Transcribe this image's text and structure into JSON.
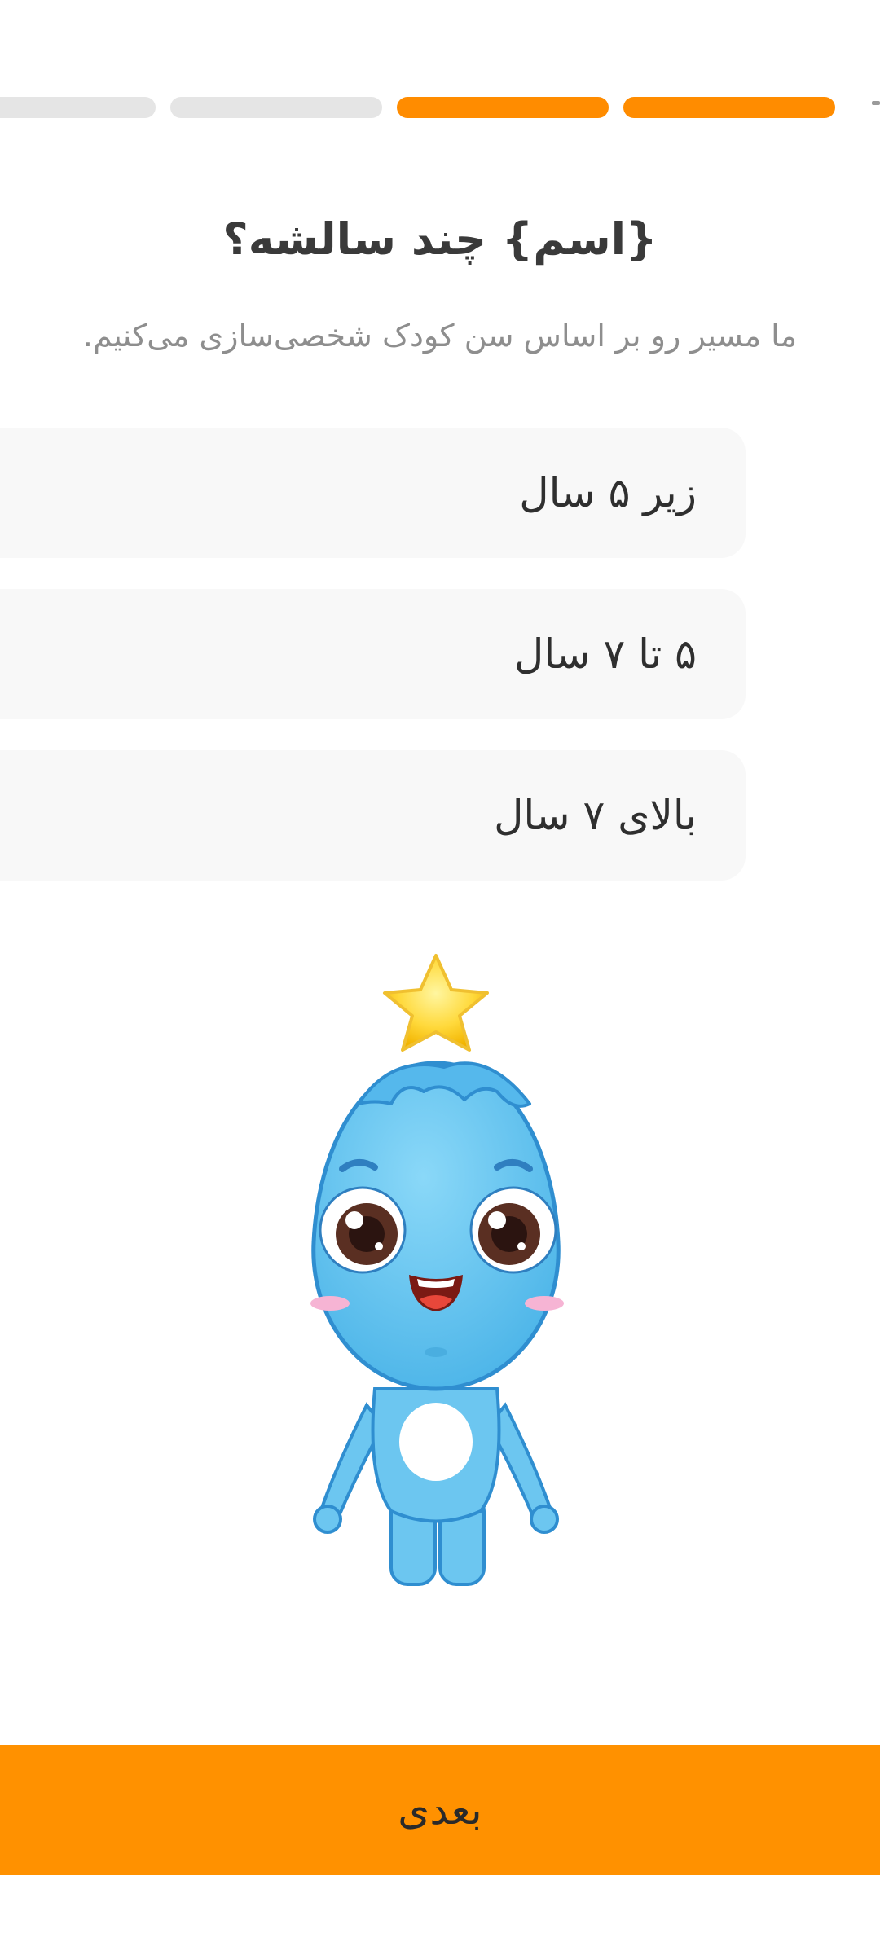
{
  "progress": {
    "total_steps": 4,
    "completed_steps": 2
  },
  "question": {
    "title": "{اسم} چند سالشه؟",
    "subtitle": "ما مسیر رو بر اساس سن کودک شخصی‌سازی می‌کنیم."
  },
  "options": [
    {
      "label": "زیر ۵ سال"
    },
    {
      "label": "۵ تا ۷ سال"
    },
    {
      "label": "بالای ۷ سال"
    }
  ],
  "mascot": {
    "icon": "blue-mascot-with-star"
  },
  "footer": {
    "next_label": "بعدی"
  },
  "colors": {
    "accent": "#ff9100",
    "progress_inactive": "#e5e5e5",
    "option_bg": "#f8f8f8"
  }
}
